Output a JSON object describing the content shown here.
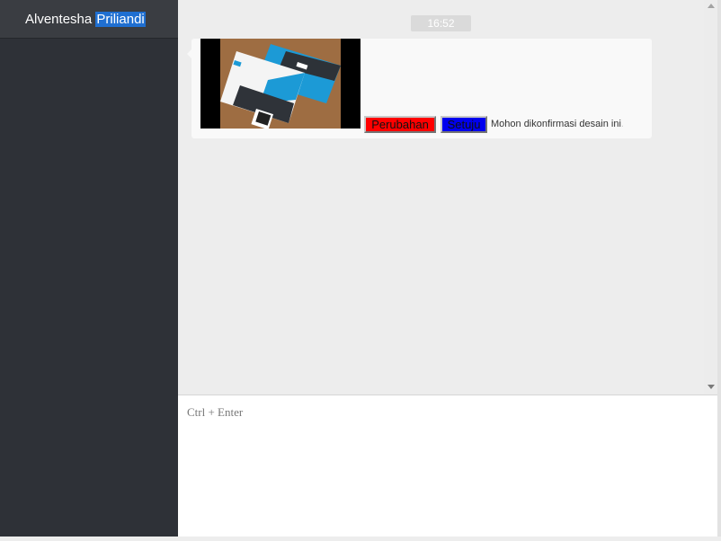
{
  "sidebar": {
    "contact_first": "Alventesha ",
    "contact_last": "Priliandi"
  },
  "chat": {
    "timestamp": "16:52",
    "message": {
      "image_alt": "business card design",
      "buttons": {
        "change_label": "Perubahan",
        "approve_label": "Setuju"
      },
      "text": "Mohon dikonfirmasi desain ini",
      "trail": "."
    }
  },
  "composer": {
    "placeholder": "Ctrl + Enter"
  },
  "colors": {
    "sidebar_bg": "#2e3137",
    "change_button": "#ff0000",
    "approve_button": "#0000ee",
    "selection": "#1f6fd1"
  }
}
